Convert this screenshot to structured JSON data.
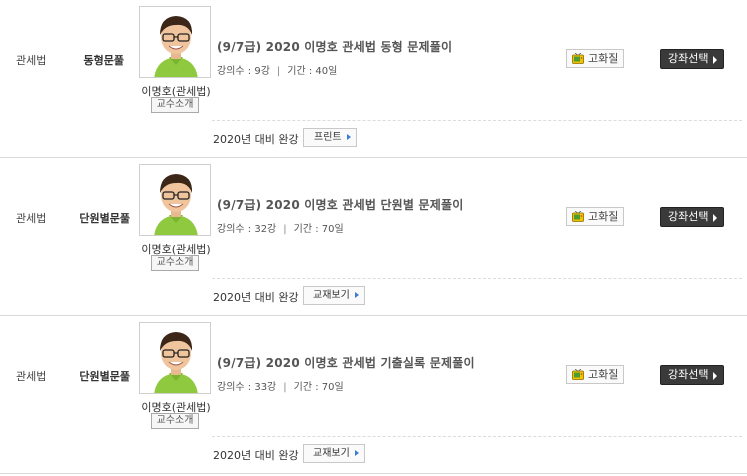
{
  "rows": [
    {
      "subject": "관세법",
      "type": "동형문풀",
      "professor_name": "이명호(관세법)",
      "professor_button": "교수소개",
      "title": "(9/7급) 2020 이명호 관세법 동형 문제풀이",
      "lecture_count": "강의수 : 9강",
      "period": "기간 : 40일",
      "hd_label": "고화질",
      "select_label": "강좌선택",
      "complete_text": "2020년 대비 완강",
      "book_label": "프린트"
    },
    {
      "subject": "관세법",
      "type": "단원별문풀",
      "professor_name": "이명호(관세법)",
      "professor_button": "교수소개",
      "title": "(9/7급) 2020 이명호 관세법 단원별 문제풀이",
      "lecture_count": "강의수 : 32강",
      "period": "기간 : 70일",
      "hd_label": "고화질",
      "select_label": "강좌선택",
      "complete_text": "2020년 대비 완강",
      "book_label": "교재보기"
    },
    {
      "subject": "관세법",
      "type": "단원별문풀",
      "professor_name": "이명호(관세법)",
      "professor_button": "교수소개",
      "title": "(9/7급) 2020 이명호 관세법 기출실록 문제풀이",
      "lecture_count": "강의수 : 33강",
      "period": "기간 : 70일",
      "hd_label": "고화질",
      "select_label": "강좌선택",
      "complete_text": "2020년 대비 완강",
      "book_label": "교재보기"
    }
  ],
  "icons": {
    "hd": "tv-icon",
    "select": "triangle-right-icon",
    "book": "triangle-right-icon"
  },
  "colors": {
    "select_button_bg": "#3a3a3a",
    "book_arrow": "#3a7bd5",
    "row_border": "#d9d9d9"
  }
}
